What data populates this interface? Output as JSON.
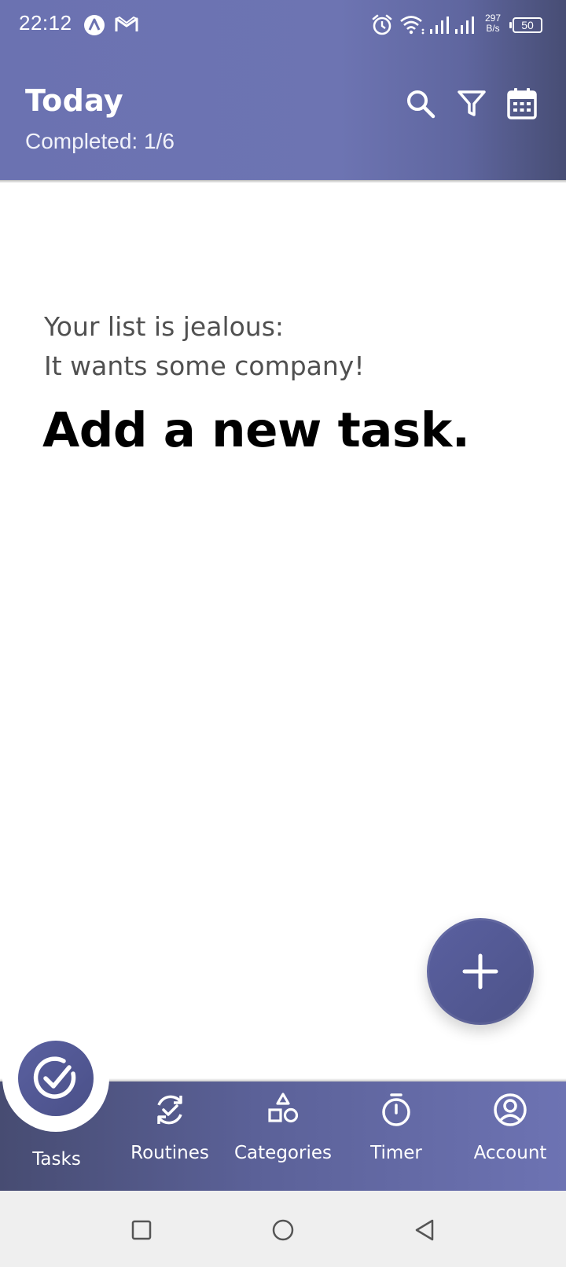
{
  "status_bar": {
    "time": "22:12",
    "net_speed_value": "297",
    "net_speed_unit": "B/s",
    "battery": "50",
    "icons": [
      "app-a-icon",
      "gmail-icon",
      "alarm-icon",
      "wifi-icon",
      "signal-icon",
      "signal-icon"
    ]
  },
  "header": {
    "title": "Today",
    "subtitle": "Completed: 1/6",
    "actions": [
      "search-icon",
      "filter-icon",
      "calendar-icon"
    ]
  },
  "empty_state": {
    "line1": "Your list is jealous:",
    "line2": "It wants some company!",
    "cta": "Add a new task."
  },
  "fab": {
    "icon": "plus-icon"
  },
  "bottom_nav": {
    "items": [
      {
        "label": "Tasks",
        "icon": "check-circle-icon",
        "active": true
      },
      {
        "label": "Routines",
        "icon": "routine-refresh-icon",
        "active": false
      },
      {
        "label": "Categories",
        "icon": "shapes-icon",
        "active": false
      },
      {
        "label": "Timer",
        "icon": "stopwatch-icon",
        "active": false
      },
      {
        "label": "Account",
        "icon": "account-icon",
        "active": false
      }
    ]
  },
  "system_nav": [
    "recents-button",
    "home-button",
    "back-button"
  ],
  "colors": {
    "header": "#6b72b1",
    "accent": "#555b9a",
    "nav_dark": "#474c72",
    "text_muted": "#505050"
  }
}
